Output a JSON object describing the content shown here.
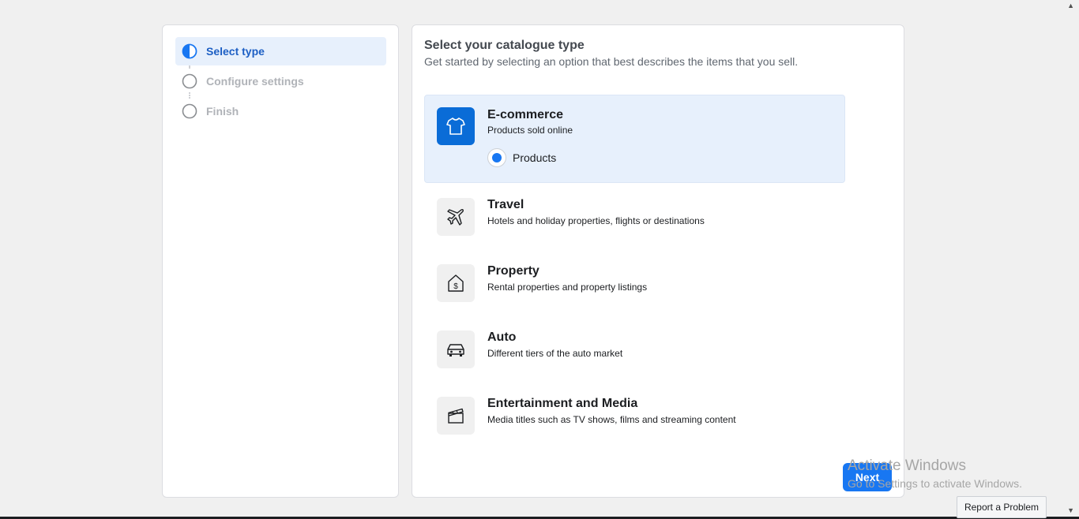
{
  "steps": [
    {
      "label": "Select type",
      "state": "active"
    },
    {
      "label": "Configure settings",
      "state": "pending"
    },
    {
      "label": "Finish",
      "state": "pending"
    }
  ],
  "main": {
    "title": "Select your catalogue type",
    "subtitle": "Get started by selecting an option that best describes the items that you sell."
  },
  "options": [
    {
      "title": "E-commerce",
      "description": "Products sold online",
      "icon": "tshirt-icon",
      "selected": true,
      "sub_option": {
        "label": "Products",
        "checked": true
      }
    },
    {
      "title": "Travel",
      "description": "Hotels and holiday properties, flights or destinations",
      "icon": "airplane-icon"
    },
    {
      "title": "Property",
      "description": "Rental properties and property listings",
      "icon": "house-dollar-icon"
    },
    {
      "title": "Auto",
      "description": "Different tiers of the auto market",
      "icon": "car-icon"
    },
    {
      "title": "Entertainment and Media",
      "description": "Media titles such as TV shows, films and streaming content",
      "icon": "clapperboard-icon"
    }
  ],
  "footer": {
    "next_label": "Next",
    "report_label": "Report a Problem"
  },
  "watermark": {
    "line1": "Activate Windows",
    "line2": "Go to Settings to activate Windows."
  },
  "colors": {
    "accent": "#1877f2",
    "selected_bg": "#e7f0fc",
    "icon_selected_bg": "#0a6cd7"
  }
}
